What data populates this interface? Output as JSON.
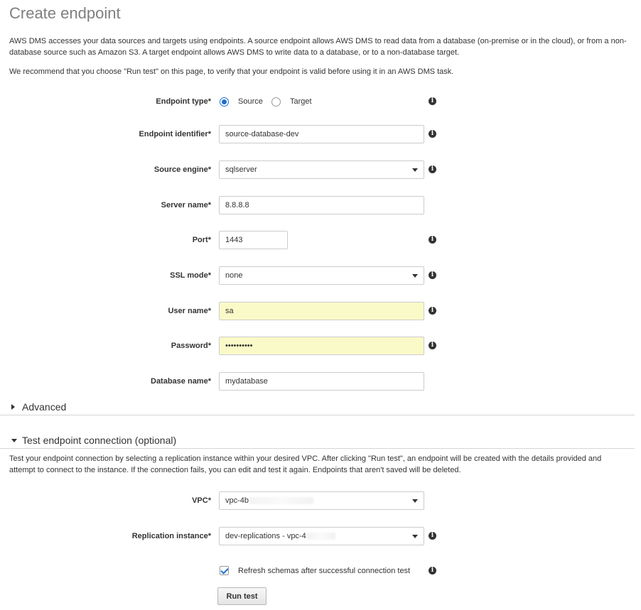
{
  "page": {
    "title": "Create endpoint",
    "intro": "AWS DMS accesses your data sources and targets using endpoints. A source endpoint allows AWS DMS to read data from a database (on-premise or in the cloud), or from a non-database source such as Amazon S3. A target endpoint allows AWS DMS to write data to a database, or to a non-database target.",
    "recommend": "We recommend that you choose \"Run test\" on this page, to verify that your endpoint is valid before using it in an AWS DMS task."
  },
  "form": {
    "endpoint_type": {
      "label": "Endpoint type*",
      "options": [
        "Source",
        "Target"
      ],
      "selected": "Source"
    },
    "endpoint_identifier": {
      "label": "Endpoint identifier*",
      "value": "source-database-dev"
    },
    "source_engine": {
      "label": "Source engine*",
      "value": "sqlserver"
    },
    "server_name": {
      "label": "Server name*",
      "value": "8.8.8.8"
    },
    "port": {
      "label": "Port*",
      "value": "1443"
    },
    "ssl_mode": {
      "label": "SSL mode*",
      "value": "none"
    },
    "user_name": {
      "label": "User name*",
      "value": "sa"
    },
    "password": {
      "label": "Password*",
      "value": "••••••••••"
    },
    "database_name": {
      "label": "Database name*",
      "value": "mydatabase"
    }
  },
  "advanced": {
    "label": "Advanced",
    "expanded": false
  },
  "test": {
    "label": "Test endpoint connection (optional)",
    "expanded": true,
    "description": "Test your endpoint connection by selecting a replication instance within your desired VPC. After clicking \"Run test\", an endpoint will be created with the details provided and attempt to connect to the instance. If the connection fails, you can edit and test it again. Endpoints that aren't saved will be deleted.",
    "vpc": {
      "label": "VPC*",
      "value": "vpc-4b"
    },
    "replication_instance": {
      "label": "Replication instance*",
      "value": "dev-replications - vpc-4"
    },
    "refresh_schemas": {
      "label": "Refresh schemas after successful connection test",
      "checked": true
    },
    "run_button": "Run test"
  },
  "icons": {
    "info": "info-icon",
    "caret": "caret-down-icon",
    "collapsed": "caret-right-icon",
    "expanded": "caret-down-icon"
  },
  "colors": {
    "accent": "#1e6fd0",
    "autofill": "#fafac8",
    "title": "#7f7f7f"
  }
}
